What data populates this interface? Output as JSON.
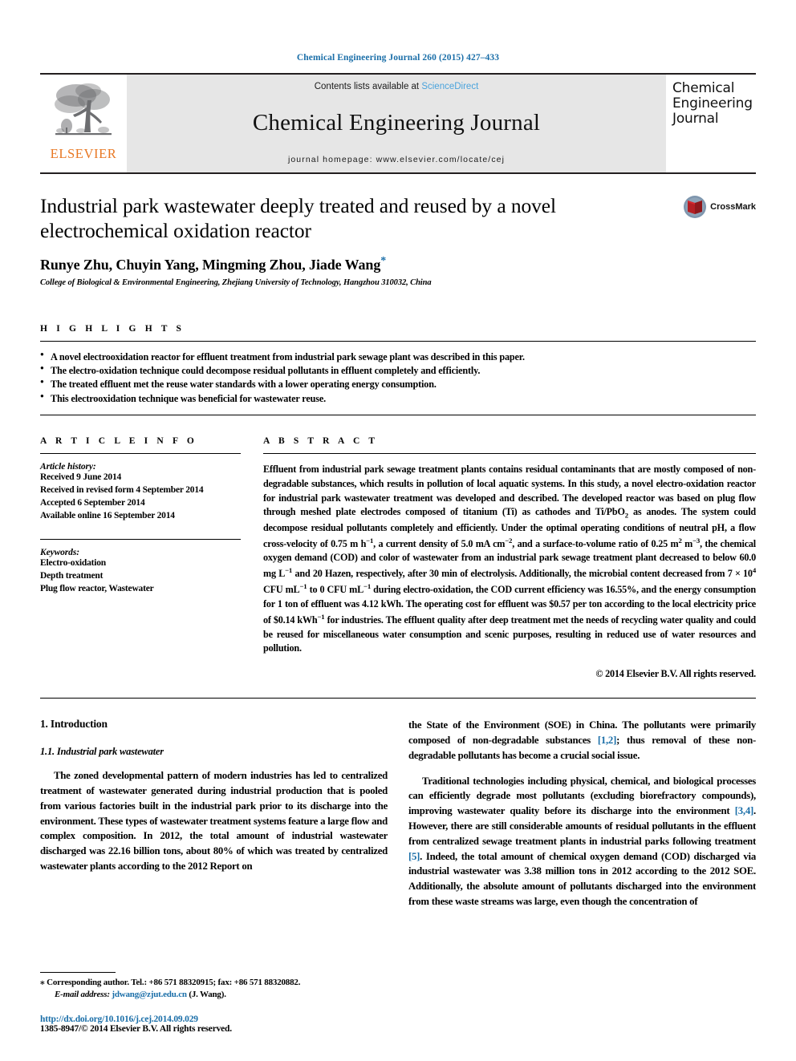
{
  "running_head": "Chemical Engineering Journal 260 (2015) 427–433",
  "masthead": {
    "contents_prefix": "Contents lists available at ",
    "sciencedirect": "ScienceDirect",
    "journal_name": "Chemical Engineering Journal",
    "homepage": "journal homepage: www.elsevier.com/locate/cej",
    "publisher_word": "ELSEVIER",
    "cover_line_1": "Chemical",
    "cover_line_2": "Engineering",
    "cover_line_3": "Journal",
    "sciencedirect_color": "#4aa3dc",
    "elsevier_orange": "#e87722",
    "panel_gray": "#e6e6e6"
  },
  "article": {
    "title": "Industrial park wastewater deeply treated and reused by a novel electrochemical oxidation reactor",
    "authors": "Runye Zhu, Chuyin Yang, Mingming Zhou, Jiade Wang",
    "corresponding_marker": "*",
    "affiliation": "College of Biological & Environmental Engineering, Zhejiang University of Technology, Hangzhou 310032, China",
    "crossmark_label": "CrossMark"
  },
  "highlights": {
    "heading": "H I G H L I G H T S",
    "items": [
      "A novel electrooxidation reactor for effluent treatment from industrial park sewage plant was described in this paper.",
      "The electro-oxidation technique could decompose residual pollutants in effluent completely and efficiently.",
      "The treated effluent met the reuse water standards with a lower operating energy consumption.",
      "This electrooxidation technique was beneficial for wastewater reuse."
    ]
  },
  "article_info": {
    "heading": "A R T I C L E    I N F O",
    "history_label": "Article history:",
    "history": [
      "Received 9 June 2014",
      "Received in revised form 4 September 2014",
      "Accepted 6 September 2014",
      "Available online 16 September 2014"
    ],
    "keywords_label": "Keywords:",
    "keywords": [
      "Electro-oxidation",
      "Depth treatment",
      "Plug flow reactor, Wastewater"
    ]
  },
  "abstract": {
    "heading": "A B S T R A C T",
    "paragraph_part1": "Effluent from industrial park sewage treatment plants contains residual contaminants that are mostly composed of non-degradable substances, which results in pollution of local aquatic systems. In this study, a novel electro-oxidation reactor for industrial park wastewater treatment was developed and described. The developed reactor was based on plug flow through meshed plate electrodes composed of titanium (Ti) as cathodes and Ti/PbO",
    "sub1": "2",
    "paragraph_part2": " as anodes. The system could decompose residual pollutants completely and efficiently. Under the optimal operating conditions of neutral pH, a flow cross-velocity of 0.75 m h",
    "sup1": "−1",
    "paragraph_part3": ", a current density of 5.0 mA cm",
    "sup2": "−2",
    "paragraph_part4": ", and a surface-to-volume ratio of 0.25 m",
    "sup3": "2",
    "paragraph_part5": " m",
    "sup4": "−3",
    "paragraph_part6": ", the chemical oxygen demand (COD) and color of wastewater from an industrial park sewage treatment plant decreased to below 60.0 mg L",
    "sup5": "−1",
    "paragraph_part7": " and 20 Hazen, respectively, after 30 min of electrolysis. Additionally, the microbial content decreased from 7 × 10",
    "sup6": "4",
    "paragraph_part8": " CFU mL",
    "sup7": "−1",
    "paragraph_part9": " to 0 CFU mL",
    "sup8": "−1",
    "paragraph_part10": " during electro-oxidation, the COD current efficiency was 16.55%, and the energy consumption for 1 ton of effluent was 4.12 kWh. The operating cost for effluent was $0.57 per ton according to the local electricity price of $0.14 kWh",
    "sup9": "−1",
    "paragraph_part11": " for industries. The effluent quality after deep treatment met the needs of recycling water quality and could be reused for miscellaneous water consumption and scenic purposes, resulting in reduced use of water resources and pollution.",
    "copyright": "© 2014 Elsevier B.V. All rights reserved."
  },
  "body": {
    "section_number_title": "1. Introduction",
    "subsection_title": "1.1. Industrial park wastewater",
    "left_paragraph_1": "The zoned developmental pattern of modern industries has led to centralized treatment of wastewater generated during industrial production that is pooled from various factories built in the industrial park prior to its discharge into the environment. These types of wastewater treatment systems feature a large flow and complex composition. In 2012, the total amount of industrial wastewater discharged was 22.16 billion tons, about 80% of which was treated by centralized wastewater plants according to the 2012 Report on",
    "right_paragraph_1a": "the State of the Environment (SOE) in China. The pollutants were primarily composed of non-degradable substances ",
    "right_ref_1": "[1,2]",
    "right_paragraph_1b": "; thus removal of these non-degradable pollutants has become a crucial social issue.",
    "right_paragraph_2a": "Traditional technologies including physical, chemical, and biological processes can efficiently degrade most pollutants (excluding biorefractory compounds), improving wastewater quality before its discharge into the environment ",
    "right_ref_2": "[3,4]",
    "right_paragraph_2b": ". However, there are still considerable amounts of residual pollutants in the effluent from centralized sewage treatment plants in industrial parks following treatment ",
    "right_ref_3": "[5]",
    "right_paragraph_2c": ". Indeed, the total amount of chemical oxygen demand (COD) discharged via industrial wastewater was 3.38 million tons in 2012 according to the 2012 SOE. Additionally, the absolute amount of pollutants discharged into the environment from these waste streams was large, even though the concentration of"
  },
  "footer": {
    "corresponding_marker": "⁎",
    "corresponding_text": "Corresponding author. Tel.: +86 571 88320915; fax: +86 571 88320882.",
    "email_label": "E-mail address:",
    "email": "jdwang@zjut.edu.cn",
    "email_suffix": "(J. Wang).",
    "doi": "http://dx.doi.org/10.1016/j.cej.2014.09.029",
    "issn_line": "1385-8947/© 2014 Elsevier B.V. All rights reserved.",
    "link_color": "#1a6ea8"
  }
}
